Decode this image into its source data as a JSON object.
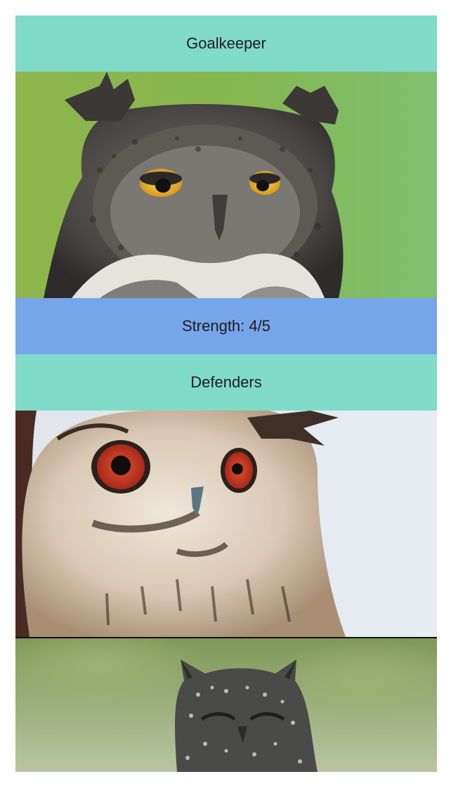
{
  "colors": {
    "header_bg": "#80dbc8",
    "strength_bg": "#77a5ea",
    "text": "#1d1d1d"
  },
  "sections": [
    {
      "title": "Goalkeeper",
      "players": [
        {
          "photo_icon": "great-horned-owl-photo",
          "strength_label": "Strength: 4/5",
          "strength": 4,
          "strength_max": 5
        }
      ]
    },
    {
      "title": "Defenders",
      "players": [
        {
          "photo_icon": "eurasian-eagle-owl-photo"
        },
        {
          "photo_icon": "spotted-eagle-owl-photo"
        }
      ]
    }
  ]
}
